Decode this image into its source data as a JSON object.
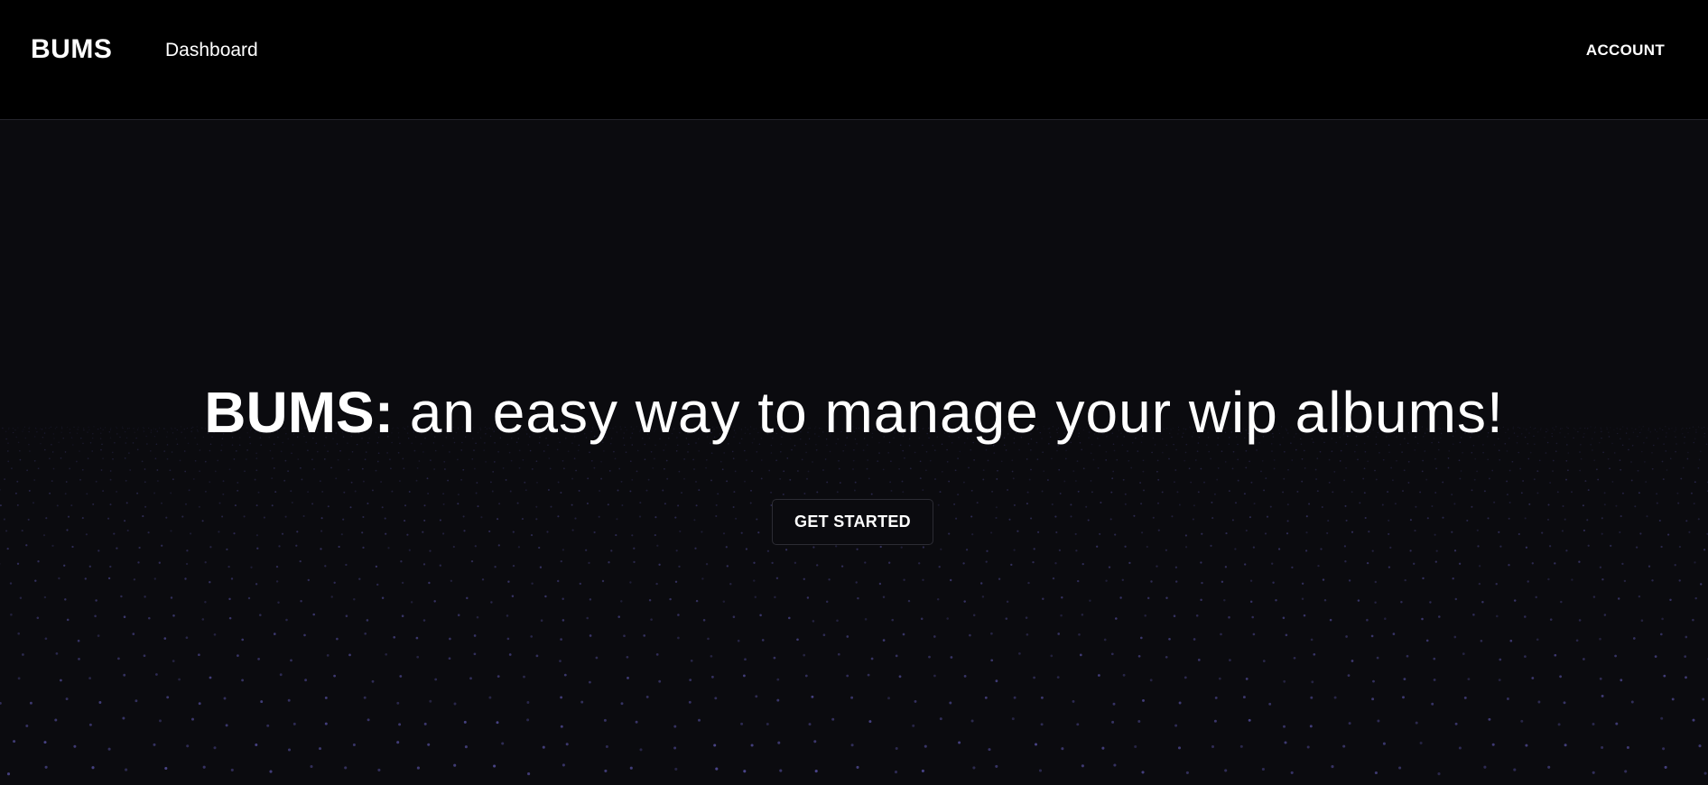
{
  "header": {
    "brand": "BUMS",
    "nav_dashboard": "Dashboard",
    "account_label": "ACCOUNT"
  },
  "hero": {
    "headline_strong": "BUMS:",
    "headline_rest": "an easy way to manage your wip albums!",
    "cta_label": "GET STARTED"
  },
  "colors": {
    "header_bg": "#000000",
    "page_bg": "#0b0b0f",
    "text": "#ffffff",
    "particle": "#6b63c9"
  }
}
